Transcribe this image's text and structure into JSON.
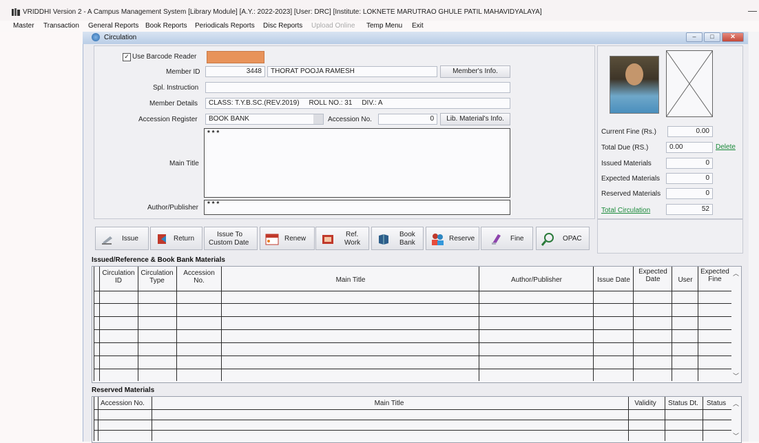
{
  "app": {
    "title": "VRIDDHI Version 2 - A Campus Management System [Library Module] [A.Y.: 2022-2023] [User: DRC] [Institute: LOKNETE MARUTRAO GHULE PATIL MAHAVIDYALAYA]",
    "minimize": "—"
  },
  "menu": {
    "items": [
      {
        "label": "Master"
      },
      {
        "label": "Transaction"
      },
      {
        "label": "General Reports"
      },
      {
        "label": "Book Reports"
      },
      {
        "label": "Periodicals Reports"
      },
      {
        "label": "Disc Reports"
      },
      {
        "label": "Upload Online",
        "disabled": true
      },
      {
        "label": "Temp Menu"
      },
      {
        "label": "Exit"
      }
    ]
  },
  "window": {
    "title": "Circulation",
    "min": "–",
    "max": "□",
    "close": "✕"
  },
  "form": {
    "use_barcode_label": "Use Barcode Reader",
    "use_barcode_checked": "✓",
    "member_id_label": "Member ID",
    "member_id": "3448",
    "member_name": "THORAT POOJA RAMESH",
    "member_info_btn": "Member's Info.",
    "spl_instruction_label": "Spl. Instruction",
    "spl_instruction": "",
    "member_details_label": "Member Details",
    "member_details": "CLASS: T.Y.B.SC.(REV.2019)     ROLL NO.: 31     DIV.: A",
    "accession_register_label": "Accession Register",
    "accession_register": "BOOK BANK",
    "accession_no_label": "Accession No.",
    "accession_no": "0",
    "lib_material_btn": "Lib. Material's Info.",
    "main_title_label": "Main Title",
    "main_title": "* * *",
    "author_label": "Author/Publisher",
    "author": "* * *"
  },
  "stats": {
    "current_fine_label": "Current Fine (Rs.)",
    "current_fine": "0.00",
    "total_due_label": "Total Due (RS.)",
    "total_due": "0.00",
    "delete_link": "Delete",
    "issued_label": "Issued Materials",
    "issued": "0",
    "expected_label": "Expected Materials",
    "expected": "0",
    "reserved_label": "Reserved Materials",
    "reserved": "0",
    "total_circ_label": "Total Circulation",
    "total_circ": "52"
  },
  "toolbar": {
    "issue": "Issue",
    "return": "Return",
    "issue_custom_1": "Issue To",
    "issue_custom_2": "Custom Date",
    "renew": "Renew",
    "ref_1": "Ref.",
    "ref_2": "Work",
    "book_bank_1": "Book",
    "book_bank_2": "Bank",
    "reserve": "Reserve",
    "fine": "Fine",
    "opac": "OPAC"
  },
  "issued_grid": {
    "title": "Issued/Reference & Book Bank Materials",
    "headers": {
      "circ_id_1": "Circulation",
      "circ_id_2": "ID",
      "circ_type_1": "Circulation",
      "circ_type_2": "Type",
      "acc_no_1": "Accession",
      "acc_no_2": "No.",
      "main_title": "Main Title",
      "author": "Author/Publisher",
      "issue_date": "Issue Date",
      "exp_date_1": "Expected",
      "exp_date_2": "Date",
      "user": "User",
      "exp_fine_1": "Expected",
      "exp_fine_2": "Fine"
    }
  },
  "reserved_grid": {
    "title": "Reserved Materials",
    "headers": {
      "acc_no": "Accession No.",
      "main_title": "Main Title",
      "validity": "Validity",
      "status_dt": "Status Dt.",
      "status": "Status"
    }
  },
  "colors": {
    "barcode_field": "#e8935a",
    "link_green": "#1a8a3a"
  }
}
